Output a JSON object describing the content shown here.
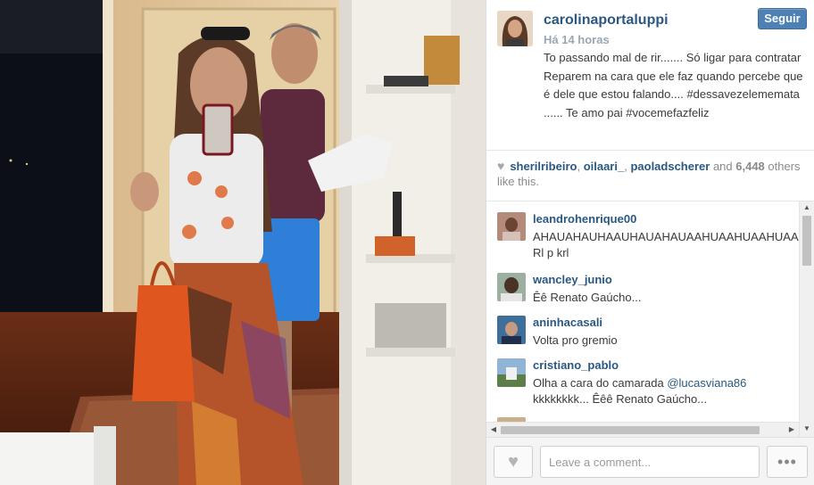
{
  "post": {
    "username": "carolinaportaluppi",
    "time": "Há 14 horas",
    "follow_label": "Seguir",
    "caption": "To passando mal de rir....... Só ligar para contratar Reparem na cara que ele faz quando percebe que é dele que estou falando.... #dessavezelememata ...... Te amo pai #vocemefazfeliz"
  },
  "likes": {
    "icon": "heart-icon",
    "user1": "sherilribeiro",
    "sep1": ", ",
    "user2": "oilaari_",
    "sep2": ", ",
    "user3": "paoladscherer",
    "and": " and ",
    "count": "6,448",
    "suffix": " others like this."
  },
  "comments": [
    {
      "user": "leandrohenrique00",
      "text": "AHAUAHAUHAAUHAUAHAUAAHUAAHUAAHUAAHUAAHUAAHUA",
      "text2": "Rl p krl"
    },
    {
      "user": "wancley_junio",
      "text": "Êê Renato Gaúcho..."
    },
    {
      "user": "aninhacasali",
      "text": "Volta pro gremio"
    },
    {
      "user": "cristiano_pablo",
      "text_before": "Olha a cara do camarada ",
      "mention": "@lucasviana86",
      "text2": "kkkkkkkk... Êêê Renato Gaúcho..."
    }
  ],
  "footer": {
    "comment_placeholder": "Leave a comment...",
    "like_icon": "heart-icon",
    "more_label": "•••"
  },
  "colors": {
    "link": "#2a5882",
    "follow_button": "#4d80b5",
    "muted": "#9aa7b3"
  }
}
